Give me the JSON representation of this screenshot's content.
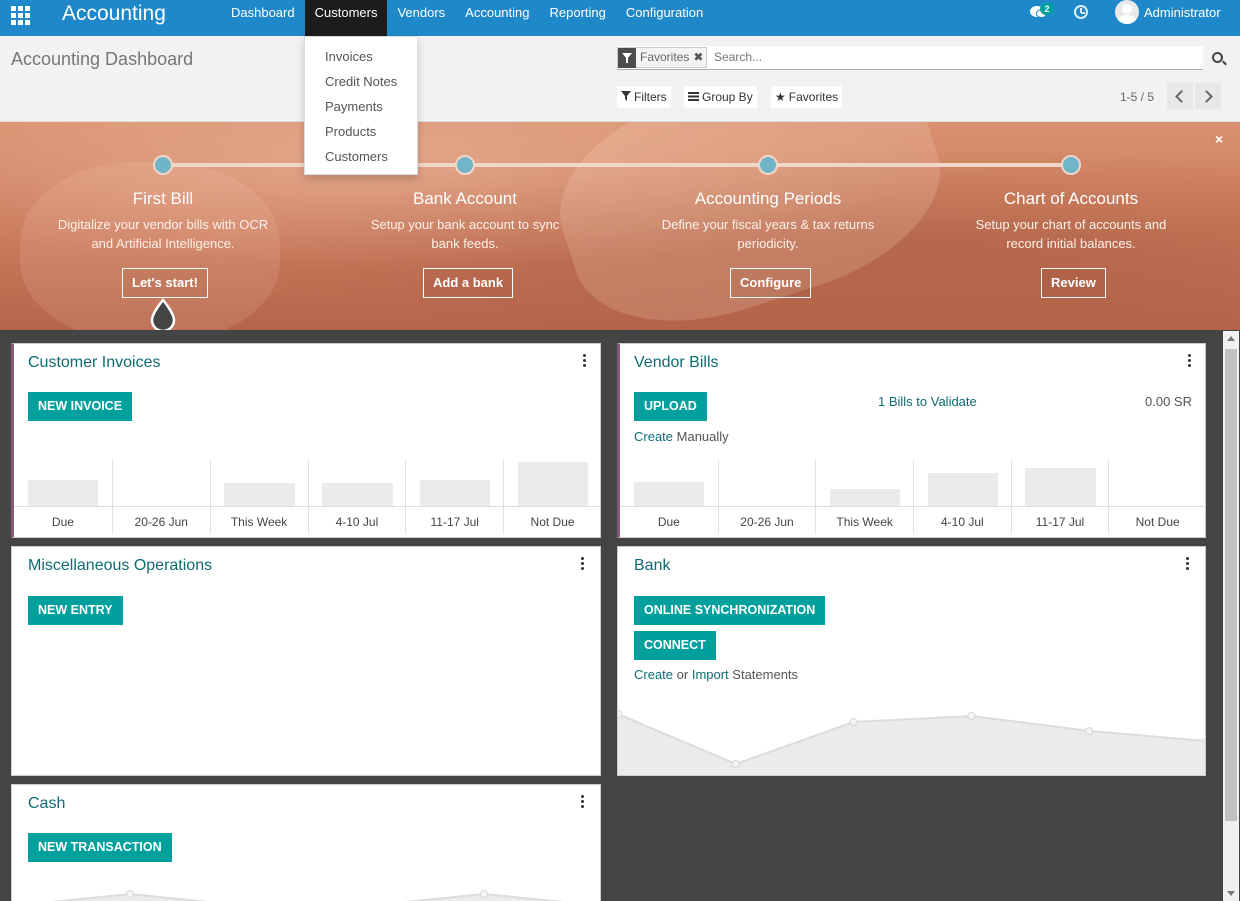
{
  "navbar": {
    "brand": "Accounting",
    "menu": [
      "Dashboard",
      "Customers",
      "Vendors",
      "Accounting",
      "Reporting",
      "Configuration"
    ],
    "active_menu": "Customers",
    "chat_badge": "2",
    "username": "Administrator"
  },
  "dropdown": {
    "items": [
      "Invoices",
      "Credit Notes",
      "Payments",
      "Products",
      "Customers"
    ]
  },
  "control": {
    "page_title": "Accounting Dashboard",
    "facet": "Favorites",
    "facet_remove": "✖",
    "search_placeholder": "Search...",
    "filters_label": "Filters",
    "groupby_label": "Group By",
    "favorites_label": "Favorites",
    "pager": "1-5 / 5"
  },
  "banner": {
    "close": "×",
    "steps": [
      {
        "title": "First Bill",
        "desc1": "Digitalize your vendor bills with OCR",
        "desc2": "and Artificial Intelligence.",
        "button": "Let's start!"
      },
      {
        "title": "Bank Account",
        "desc1": "Setup your bank account to sync",
        "desc2": "bank feeds.",
        "button": "Add a bank"
      },
      {
        "title": "Accounting Periods",
        "desc1": "Define your fiscal years & tax returns",
        "desc2": "periodicity.",
        "button": "Configure"
      },
      {
        "title": "Chart of Accounts",
        "desc1": "Setup your chart of accounts and",
        "desc2": "record initial balances.",
        "button": "Review"
      }
    ]
  },
  "cards": {
    "customer_invoices": {
      "title": "Customer Invoices",
      "button": "NEW INVOICE",
      "chart_labels": [
        "Due",
        "20-26 Jun",
        "This Week",
        "4-10 Jul",
        "11-17 Jul",
        "Not Due"
      ],
      "chart_values": [
        26,
        0,
        23,
        23,
        26,
        44
      ]
    },
    "vendor_bills": {
      "title": "Vendor Bills",
      "button": "UPLOAD",
      "validate_link": "1 Bills to Validate",
      "amount": "0.00 SR",
      "create_link": "Create",
      "create_suffix": " Manually",
      "chart_labels": [
        "Due",
        "20-26 Jun",
        "This Week",
        "4-10 Jul",
        "11-17 Jul",
        "Not Due"
      ],
      "chart_values": [
        24,
        0,
        17,
        33,
        38,
        0
      ]
    },
    "misc": {
      "title": "Miscellaneous Operations",
      "button": "NEW ENTRY"
    },
    "bank": {
      "title": "Bank",
      "button1": "ONLINE SYNCHRONIZATION",
      "button2": "CONNECT",
      "create_link": "Create",
      "or_text": " or ",
      "import_link": "Import",
      "statements_text": " Statements",
      "line_values": [
        58,
        8,
        50,
        56,
        41,
        31
      ]
    },
    "cash": {
      "title": "Cash",
      "button": "NEW TRANSACTION",
      "line_values": [
        0,
        12,
        0,
        0,
        12,
        0
      ]
    }
  }
}
